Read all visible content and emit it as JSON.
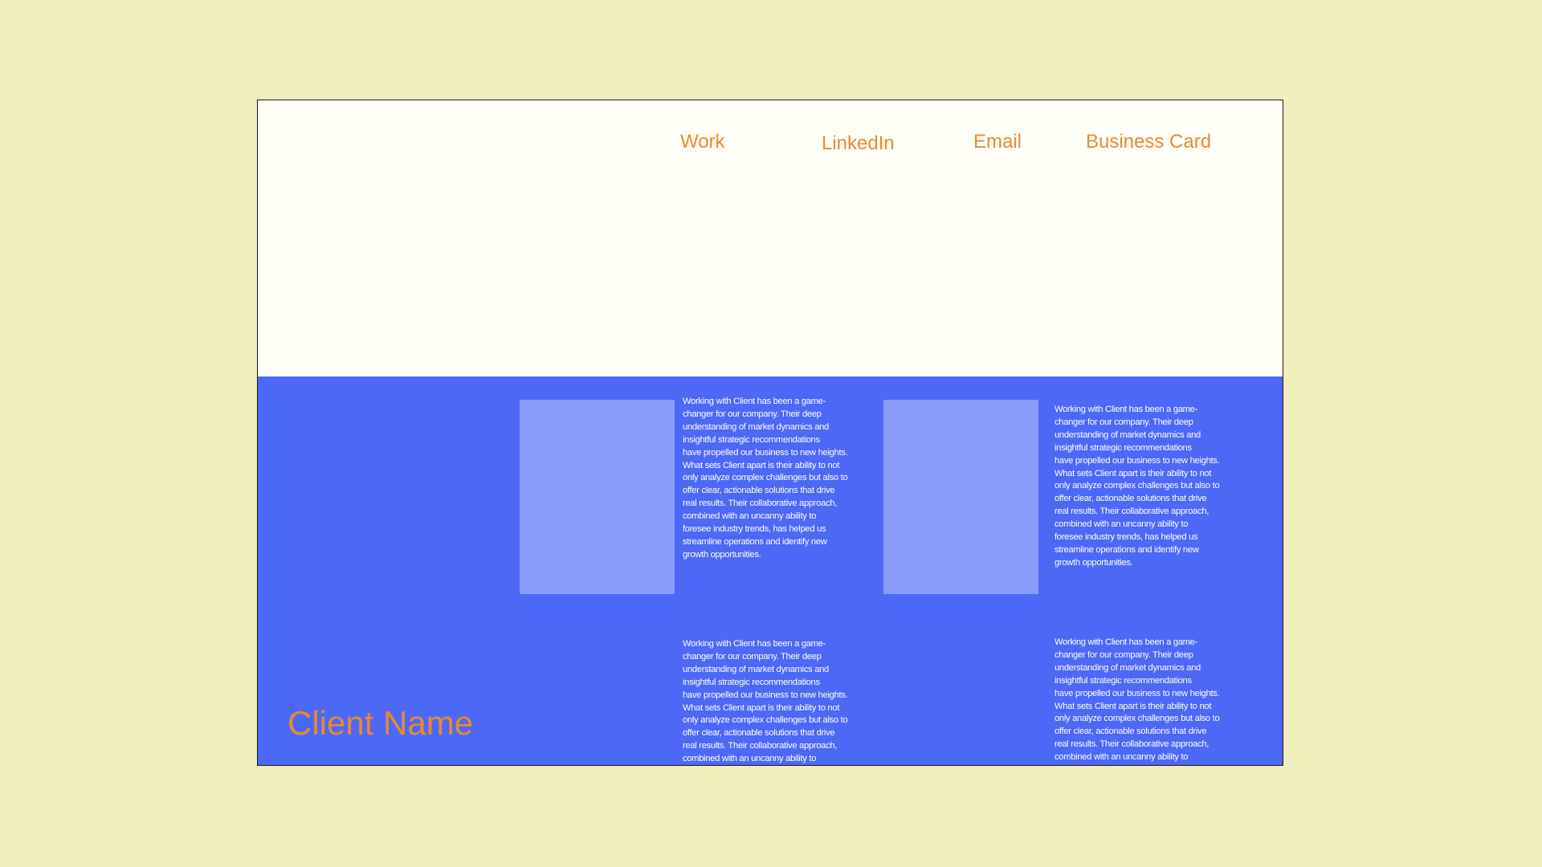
{
  "nav": {
    "work": "Work",
    "linkedin": "LinkedIn",
    "email": "Email",
    "business_card": "Business Card"
  },
  "testimonials": [
    "Working with Client has been a game-\nchanger for our company. Their deep\nunderstanding of market dynamics and\ninsightful strategic recommendations\nhave propelled our business to new heights.\nWhat sets Client apart is their ability to not\nonly analyze complex challenges but also to\noffer clear, actionable solutions that drive\nreal results. Their collaborative approach,\ncombined with an uncanny ability to\n foresee industry trends, has helped us\nstreamline operations and identify new\ngrowth opportunities.",
    "Working with Client has been a game-\nchanger for our company. Their deep\nunderstanding of market dynamics and\ninsightful strategic recommendations\nhave propelled our business to new heights.\nWhat sets Client apart is their ability to not\nonly analyze complex challenges but also to\noffer clear, actionable solutions that drive\nreal results. Their collaborative approach,\ncombined with an uncanny ability to\n foresee industry trends, has helped us\nstreamline operations and identify new\ngrowth opportunities.",
    "Working with Client has been a game-\nchanger for our company. Their deep\nunderstanding of market dynamics and\ninsightful strategic recommendations\nhave propelled our business to new heights.\nWhat sets Client apart is their ability to not\nonly analyze complex challenges but also to\noffer clear, actionable solutions that drive\nreal results. Their collaborative approach,\ncombined with an uncanny ability to",
    "Working with Client has been a game-\nchanger for our company. Their deep\nunderstanding of market dynamics and\ninsightful strategic recommendations\nhave propelled our business to new heights.\nWhat sets Client apart is their ability to not\nonly analyze complex challenges but also to\noffer clear, actionable solutions that drive\nreal results. Their collaborative approach,\ncombined with an uncanny ability to"
  ],
  "client_name": "Client Name",
  "colors": {
    "page_background": "#f0efbb",
    "header_background": "#fffff8",
    "panel_background": "#4c68f7",
    "thumbnail": "#889df9",
    "accent": "#e8892f",
    "body_text": "#ffffff"
  }
}
